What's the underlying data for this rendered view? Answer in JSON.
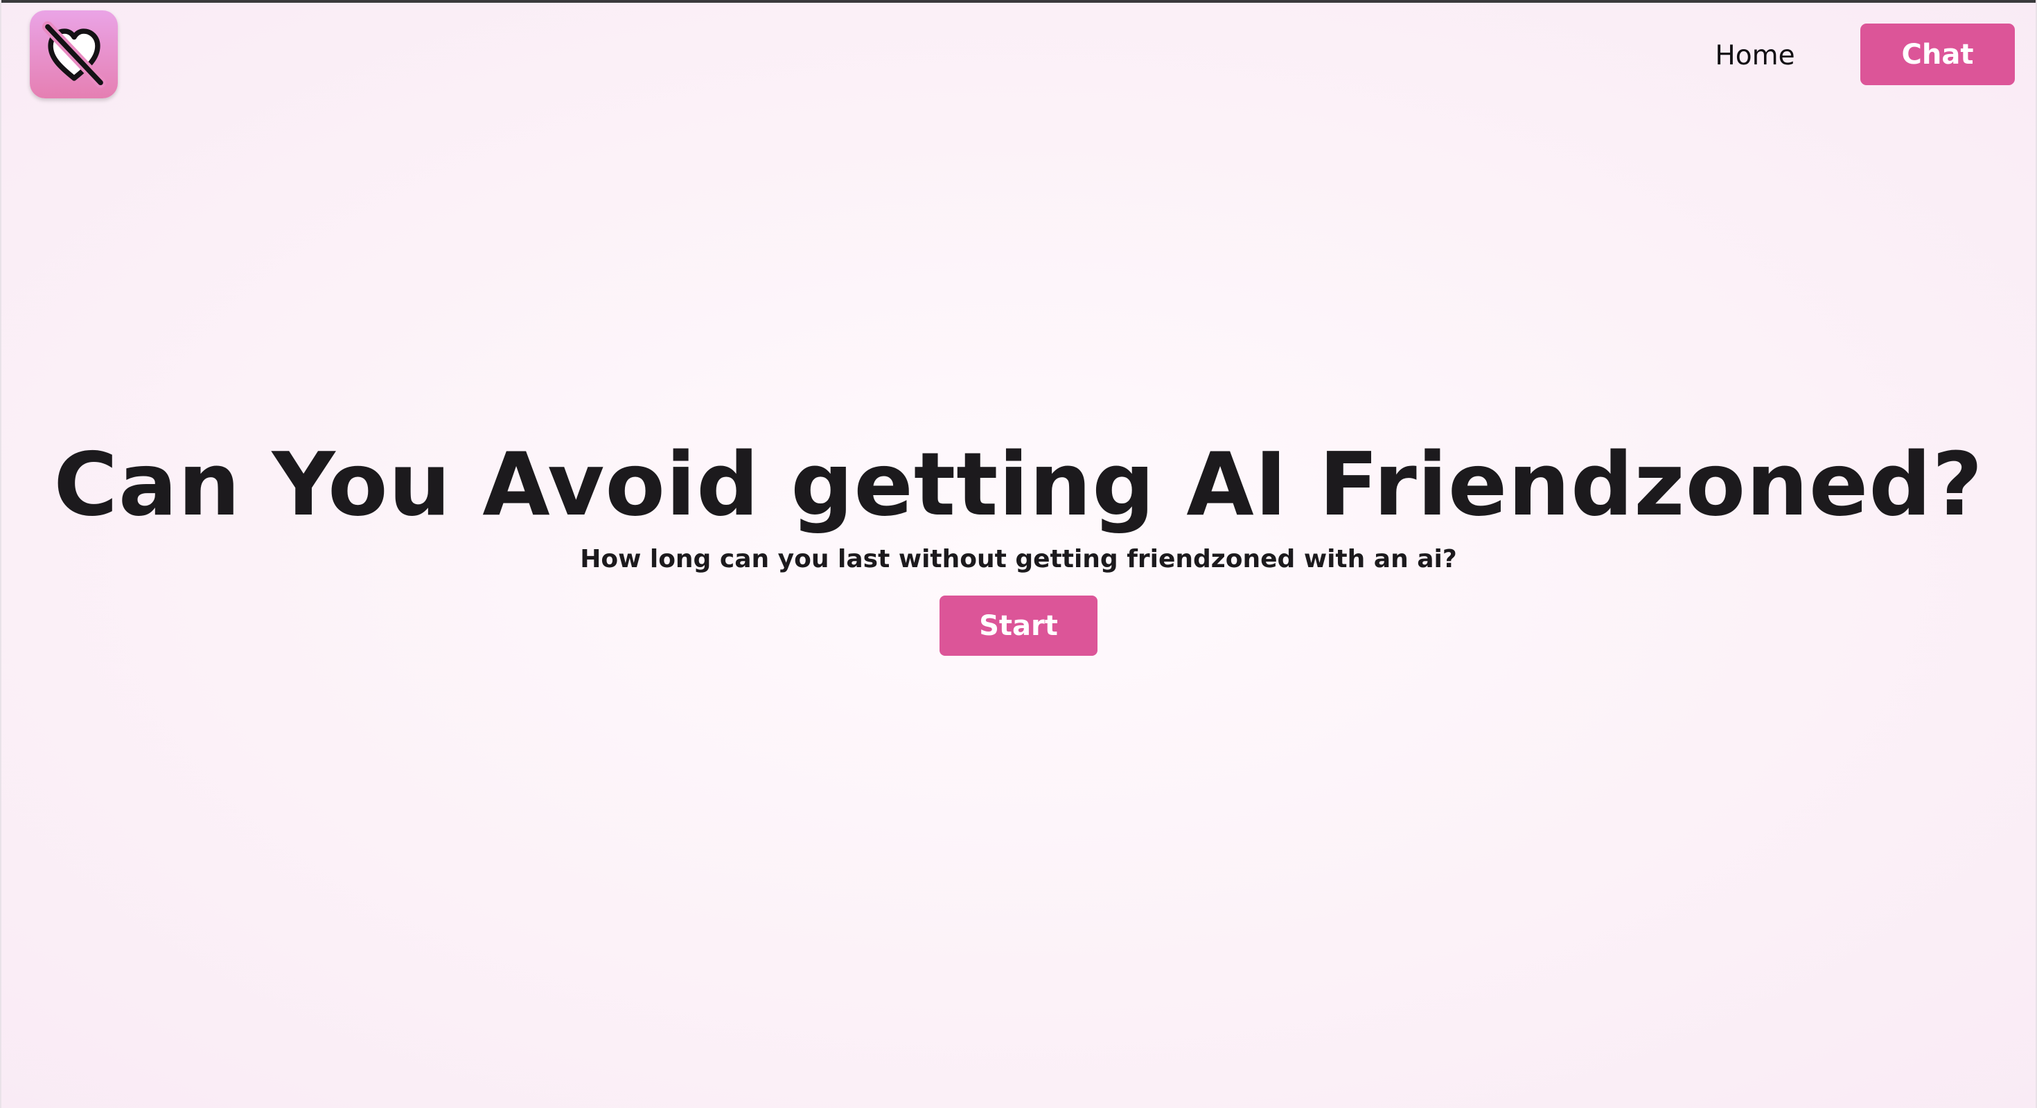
{
  "colors": {
    "accent": "#dc5598",
    "logo_gradient_top": "#eaa4e6",
    "logo_gradient_bottom": "#e57fb2",
    "text": "#1c1a1d",
    "background": "#fcf2f8"
  },
  "header": {
    "logo_icon": "heart-crossed-out-icon",
    "nav": {
      "home_label": "Home",
      "chat_label": "Chat"
    }
  },
  "hero": {
    "title": "Can You Avoid getting AI Friendzoned?",
    "subtitle": "How long can you last without getting friendzoned with an ai?",
    "start_label": "Start"
  }
}
